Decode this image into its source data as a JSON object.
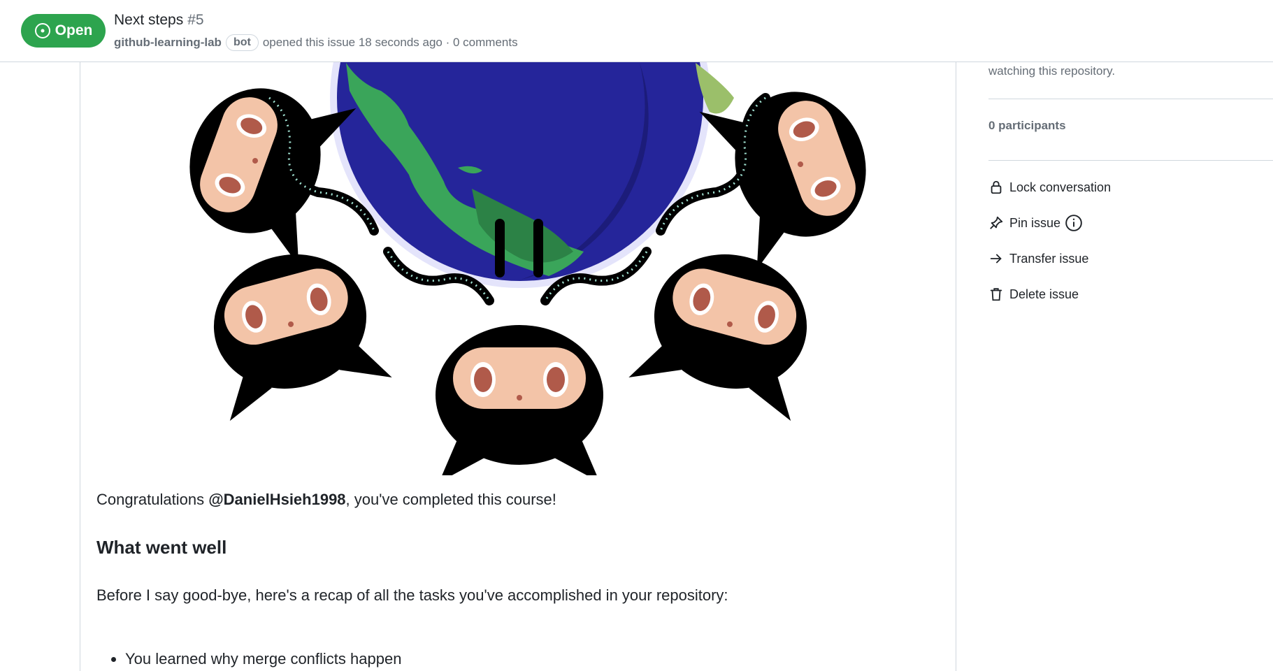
{
  "header": {
    "state_label": "Open",
    "title": "Next steps",
    "number": "#5",
    "author": "github-learning-lab",
    "bot_label": "bot",
    "meta_text": "opened this issue 18 seconds ago · 0 comments"
  },
  "comment": {
    "congrats_prefix": "Congratulations ",
    "mention": "@DanielHsieh1998",
    "congrats_suffix": ", you've completed this course!",
    "heading": "What went well",
    "recap": "Before I say good-bye, here's a recap of all the tasks you've accomplished in your repository:",
    "tasks": [
      "You learned why merge conflicts happen"
    ]
  },
  "sidebar": {
    "watching_text": "watching this repository.",
    "participants": "0 participants",
    "actions": {
      "lock": "Lock conversation",
      "pin": "Pin issue",
      "transfer": "Transfer issue",
      "delete": "Delete issue"
    }
  },
  "colors": {
    "open_green": "#2da44e",
    "border": "#d0d7de",
    "muted": "#656d76",
    "text": "#1f2328"
  }
}
